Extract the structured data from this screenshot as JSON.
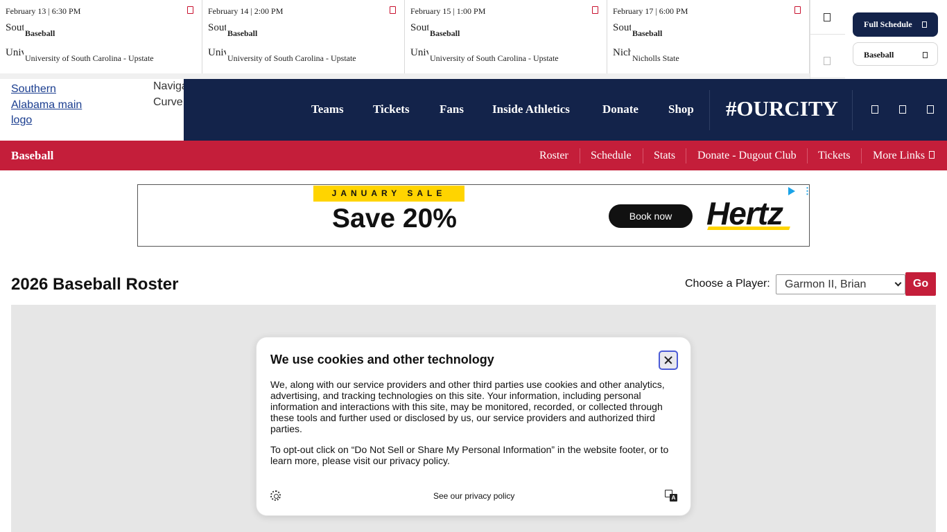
{
  "schedule": {
    "games": [
      {
        "date": "February 13 | 6:30 PM",
        "home_logo_alt": "Sout",
        "home": "Baseball",
        "away_logo_alt": "Univ",
        "away": "University of South Carolina - Upstate"
      },
      {
        "date": "February 14 | 2:00 PM",
        "home_logo_alt": "Sout",
        "home": "Baseball",
        "away_logo_alt": "Univ",
        "away": "University of South Carolina - Upstate"
      },
      {
        "date": "February 15 | 1:00 PM",
        "home_logo_alt": "Sout",
        "home": "Baseball",
        "away_logo_alt": "Univ",
        "away": "University of South Carolina - Upstate"
      },
      {
        "date": "February 17 | 6:00 PM",
        "home_logo_alt": "Sout",
        "home": "Baseball",
        "away_logo_alt": "Nich",
        "away": "Nicholls State"
      }
    ],
    "full_schedule_label": "Full Schedule",
    "sport_select_label": "Baseball"
  },
  "header": {
    "logo_alt": "Southern Alabama main logo",
    "curve_alt": "Navigation Curve",
    "nav": [
      "Teams",
      "Tickets",
      "Fans",
      "Inside Athletics",
      "Donate",
      "Shop"
    ],
    "tagline": "#OURCITY",
    "icons": [
      "search-icon",
      "user-icon",
      "menu-icon"
    ]
  },
  "subnav": {
    "title": "Baseball",
    "links": [
      "Roster",
      "Schedule",
      "Stats",
      "Donate - Dugout Club",
      "Tickets",
      "More Links"
    ]
  },
  "ad": {
    "sale_tag": "JANUARY SALE",
    "headline": "Save 20%",
    "cta": "Book now",
    "brand": "Hertz"
  },
  "roster": {
    "title": "2026 Baseball Roster",
    "choose_label": "Choose a Player:",
    "selected_player": "Garmon II, Brian",
    "go_label": "Go"
  },
  "cookie_dialog": {
    "title": "We use cookies and other technology",
    "paragraph1": "We, along with our service providers and other third parties use cookies and other analytics, advertising, and tracking technologies on this site. Your information, including personal information and interactions with this site, may be monitored, recorded, or collected through these tools and further used or disclosed by us, our service providers and authorized third parties.",
    "paragraph2": "To opt-out click on “Do Not Sell or Share My Personal Information” in the website footer, or to learn more, please visit our privacy policy.",
    "policy_link": "See our privacy policy",
    "lang_glyph": "A"
  },
  "colors": {
    "navy": "#13234a",
    "red": "#c41e3a",
    "ad_yellow": "#ffd400"
  }
}
